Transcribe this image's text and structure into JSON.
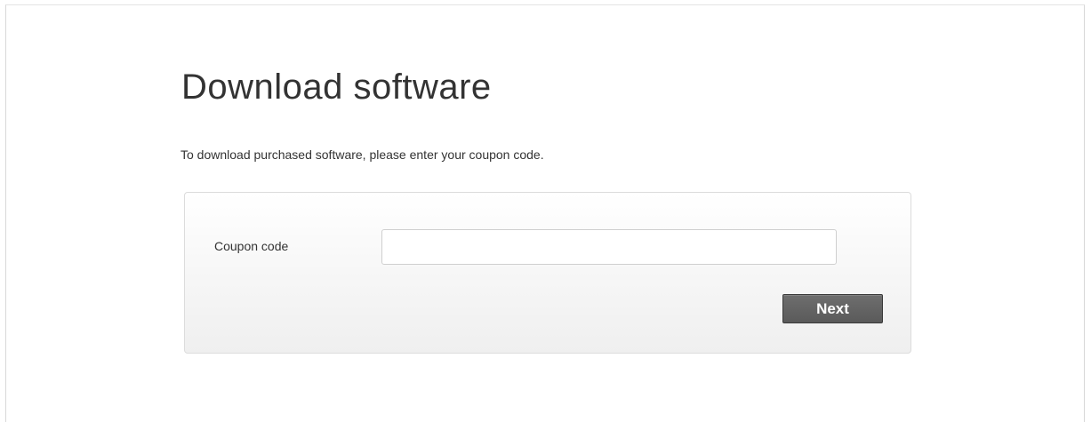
{
  "page": {
    "title": "Download software",
    "intro": "To download purchased software, please enter your coupon code."
  },
  "form": {
    "coupon_label": "Coupon code",
    "coupon_value": "",
    "coupon_placeholder": "",
    "next_label": "Next"
  }
}
